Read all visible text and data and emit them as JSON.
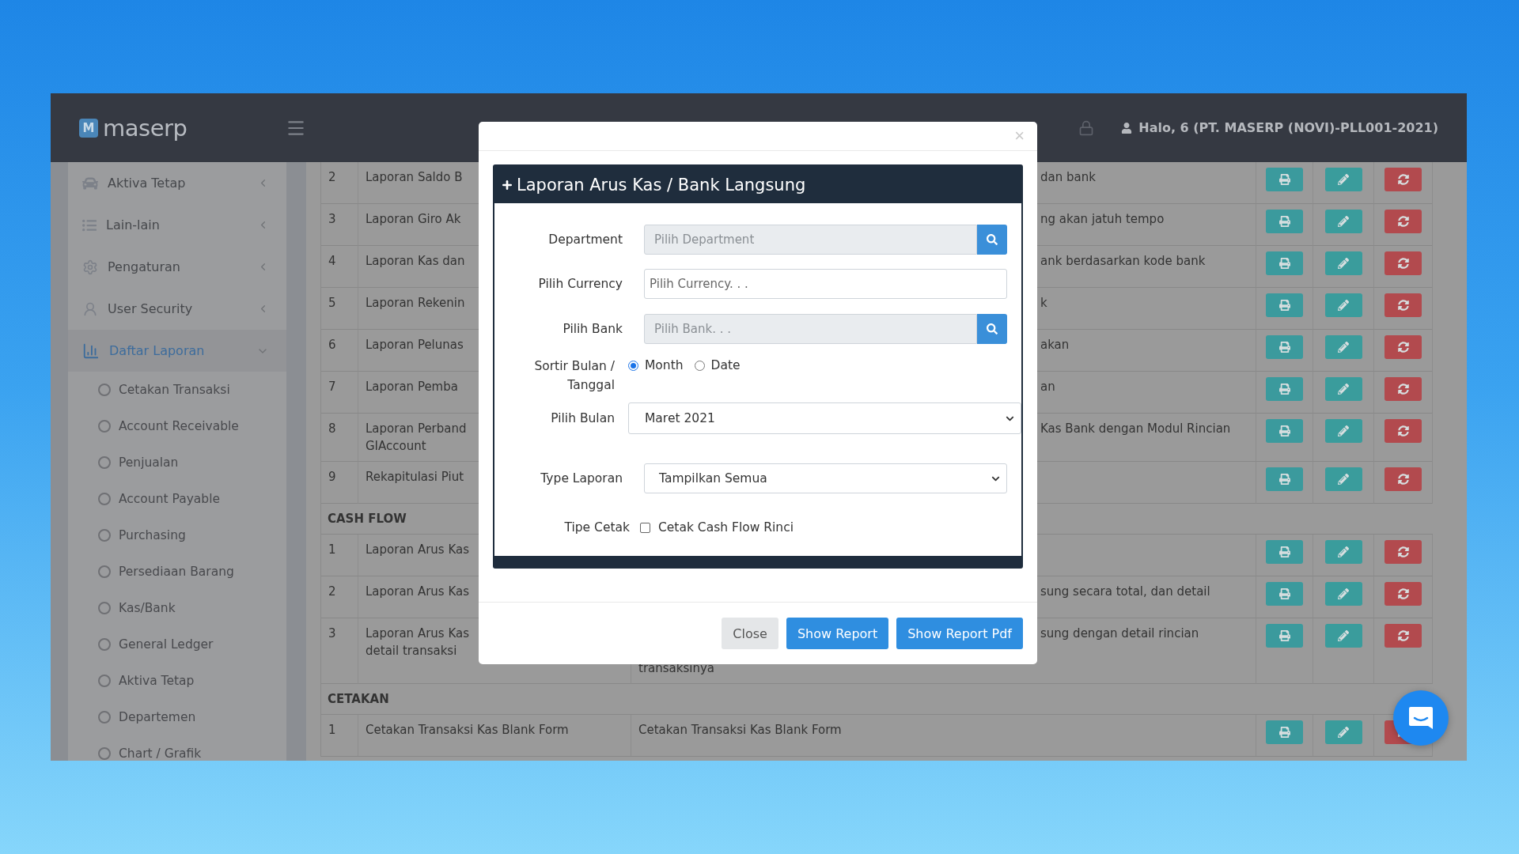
{
  "brand": {
    "logo_letter": "M",
    "name": "maserp"
  },
  "header": {
    "user": "Halo, 6 (PT. MASERP (NOVI)-PLL001-2021)"
  },
  "sidebar": {
    "items": [
      {
        "kind": "car",
        "label": "Aktiva Tetap",
        "expanded": false
      },
      {
        "kind": "list",
        "label": "Lain-lain",
        "expanded": false
      },
      {
        "kind": "gear",
        "label": "Pengaturan",
        "expanded": false
      },
      {
        "kind": "user",
        "label": "User Security",
        "expanded": false
      },
      {
        "kind": "chart",
        "label": "Daftar Laporan",
        "expanded": true,
        "children": [
          {
            "label": "Cetakan Transaksi"
          },
          {
            "label": "Account Receivable"
          },
          {
            "label": "Penjualan"
          },
          {
            "label": "Account Payable"
          },
          {
            "label": "Purchasing"
          },
          {
            "label": "Persediaan Barang"
          },
          {
            "label": "Kas/Bank"
          },
          {
            "label": "General Ledger"
          },
          {
            "label": "Aktiva Tetap"
          },
          {
            "label": "Departemen"
          },
          {
            "label": "Chart / Grafik"
          }
        ]
      }
    ]
  },
  "table": {
    "rows": [
      {
        "kind": "row",
        "number": "2",
        "name": [
          "Laporan Saldo B"
        ],
        "description": [
          "dan bank"
        ]
      },
      {
        "kind": "row",
        "number": "3",
        "name": [
          "Laporan Giro Ak"
        ],
        "description": [
          "ng akan jatuh tempo"
        ]
      },
      {
        "kind": "row",
        "number": "4",
        "name": [
          "Laporan Kas dan"
        ],
        "description": [
          "ank berdasarkan kode bank"
        ]
      },
      {
        "kind": "row",
        "number": "5",
        "name": [
          "Laporan Rekenin"
        ],
        "description": [
          "k"
        ]
      },
      {
        "kind": "row",
        "number": "6",
        "name": [
          "Laporan Pelunas"
        ],
        "description": [
          "akan"
        ]
      },
      {
        "kind": "row",
        "number": "7",
        "name": [
          "Laporan Pemba"
        ],
        "description": [
          "an"
        ]
      },
      {
        "kind": "row",
        "number": "8",
        "name": [
          "Laporan Perband",
          "GIAccount"
        ],
        "description": [
          "Kas Bank dengan Modul Rincian"
        ]
      },
      {
        "kind": "row",
        "number": "9",
        "name": [
          "Rekapitulasi Piut"
        ],
        "description": []
      },
      {
        "kind": "section",
        "title": "CASH FLOW"
      },
      {
        "kind": "row",
        "number": "1",
        "name": [
          "Laporan Arus Kas"
        ],
        "description": []
      },
      {
        "kind": "row",
        "number": "2",
        "name": [
          "Laporan Arus Kas"
        ],
        "description": [
          "sung secara total, dan detail"
        ]
      },
      {
        "kind": "row",
        "number": "3",
        "name": [
          "Laporan Arus Kas",
          "detail transaksi"
        ],
        "description": [
          "sung dengan detail rincian",
          "transaksinya"
        ]
      },
      {
        "kind": "section",
        "title": "CETAKAN"
      },
      {
        "kind": "row",
        "number": "1",
        "name": [
          "Cetakan Transaksi Kas Blank Form"
        ],
        "description": [
          "Cetakan Transaksi Kas Blank Form"
        ]
      }
    ]
  },
  "modal": {
    "close_glyph": "×",
    "title": "Laporan Arus Kas / Bank Langsung",
    "department": {
      "label": "Department",
      "placeholder": "Pilih Department"
    },
    "currency": {
      "label": "Pilih Currency",
      "placeholder": "Pilih Currency. . ."
    },
    "bank": {
      "label": "Pilih Bank",
      "placeholder": "Pilih Bank. . ."
    },
    "sort": {
      "label": [
        "Sortir Bulan /",
        "Tanggal"
      ],
      "options": [
        {
          "label": "Month",
          "selected": true
        },
        {
          "label": "Date",
          "selected": false
        }
      ]
    },
    "month": {
      "label": "Pilih Bulan",
      "value": "Maret 2021"
    },
    "report_type": {
      "label": "Type Laporan",
      "value": "Tampilkan Semua"
    },
    "print_type": {
      "label": "Tipe Cetak",
      "option": "Cetak Cash Flow Rinci",
      "checked": false
    },
    "buttons": [
      {
        "kind": "secondary",
        "label": "Close"
      },
      {
        "kind": "primary",
        "label": "Show Report"
      },
      {
        "kind": "primary",
        "label": "Show Report Pdf"
      }
    ]
  }
}
